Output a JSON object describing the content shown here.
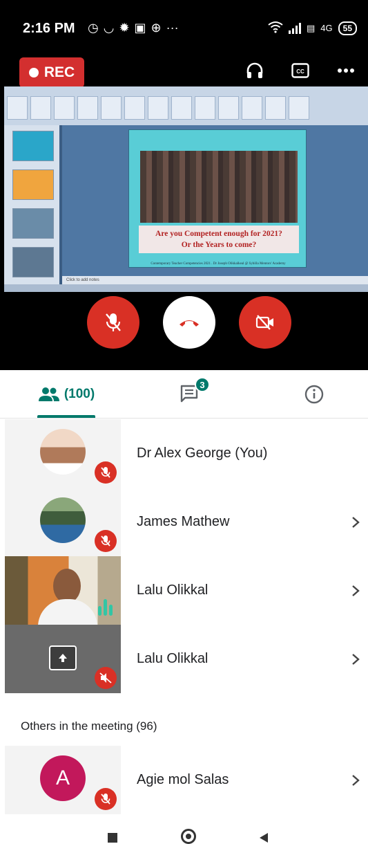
{
  "status_bar": {
    "time": "2:16 PM",
    "notif_icons": [
      "alarm-icon",
      "headset-icon",
      "settings-icon",
      "square-icon",
      "app-icon",
      "more-icon"
    ],
    "more_dots": "···",
    "network": "4G",
    "battery": "55"
  },
  "call_header": {
    "rec_label": "REC",
    "actions": [
      "headphones-icon",
      "captions-icon",
      "more-options-icon"
    ],
    "captions_label": "CC"
  },
  "presentation": {
    "slide_caption_line1": "Are you Competent enough for 2021?",
    "slide_caption_line2": "Or the Years to come?",
    "slide_footer": "Contemporary Teacher Competencies 2021 . Dr Joseph Olikkalkeal @ Sybilla Mentors' Academy",
    "notes_placeholder": "Click to add notes"
  },
  "controls": {
    "mic": "microphone-off",
    "end_call": "hang-up",
    "camera": "camera-off"
  },
  "tabs": {
    "people_count": "(100)",
    "chat_badge": "3",
    "active_tab": "people"
  },
  "participants": [
    {
      "name": "Dr Alex George (You)",
      "muted": true,
      "has_chevron": false
    },
    {
      "name": "James Mathew",
      "muted": true,
      "has_chevron": true
    },
    {
      "name": "Lalu Olikkal",
      "muted": false,
      "speaking": true,
      "has_chevron": true
    },
    {
      "name": "Lalu Olikkal",
      "presenting": true,
      "has_chevron": true
    }
  ],
  "others": {
    "header": "Others in the meeting (96)",
    "items": [
      {
        "name": "Agie mol Salas",
        "initial": "A",
        "muted": true,
        "avatar_color": "#c2185b"
      }
    ]
  },
  "colors": {
    "accent": "#00796b",
    "danger": "#d93025",
    "rec": "#d32f2f"
  }
}
